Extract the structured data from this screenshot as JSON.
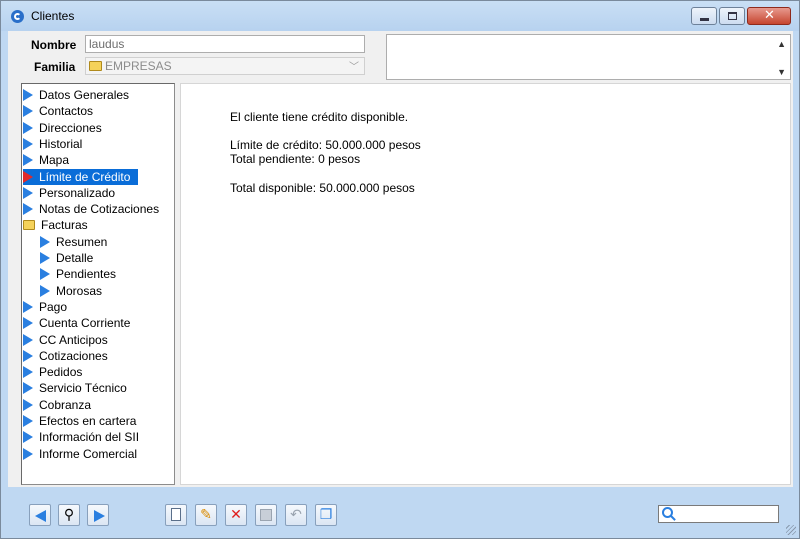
{
  "window": {
    "title": "Clientes"
  },
  "form": {
    "nombre_label": "Nombre",
    "nombre_value": "laudus",
    "familia_label": "Familia",
    "familia_value": "EMPRESAS"
  },
  "tree": {
    "items": [
      {
        "label": "Datos Generales",
        "icon": "arrow-icon"
      },
      {
        "label": "Contactos",
        "icon": "arrow-icon"
      },
      {
        "label": "Direcciones",
        "icon": "arrow-icon"
      },
      {
        "label": "Historial",
        "icon": "arrow-icon"
      },
      {
        "label": "Mapa",
        "icon": "arrow-icon"
      },
      {
        "label": "Límite de Crédito",
        "icon": "arrow-red-icon",
        "selected": true
      },
      {
        "label": "Personalizado",
        "icon": "arrow-icon"
      },
      {
        "label": "Notas de Cotizaciones",
        "icon": "arrow-icon"
      },
      {
        "label": "Facturas",
        "icon": "folder-icon"
      },
      {
        "label": "Resumen",
        "icon": "arrow-icon",
        "child": true
      },
      {
        "label": "Detalle",
        "icon": "arrow-icon",
        "child": true
      },
      {
        "label": "Pendientes",
        "icon": "arrow-icon",
        "child": true
      },
      {
        "label": "Morosas",
        "icon": "arrow-icon",
        "child": true
      },
      {
        "label": "Pago",
        "icon": "arrow-icon"
      },
      {
        "label": "Cuenta Corriente",
        "icon": "arrow-icon"
      },
      {
        "label": "CC Anticipos",
        "icon": "arrow-icon"
      },
      {
        "label": "Cotizaciones",
        "icon": "arrow-icon"
      },
      {
        "label": "Pedidos",
        "icon": "arrow-icon"
      },
      {
        "label": "Servicio Técnico",
        "icon": "arrow-icon"
      },
      {
        "label": "Cobranza",
        "icon": "arrow-icon"
      },
      {
        "label": "Efectos en cartera",
        "icon": "arrow-icon"
      },
      {
        "label": "Información del SII",
        "icon": "arrow-icon"
      },
      {
        "label": "Informe Comercial",
        "icon": "arrow-icon"
      }
    ]
  },
  "content": {
    "status": "El cliente tiene crédito disponible.",
    "limit": "Límite de crédito: 50.000.000 pesos",
    "pending": "Total pendiente: 0 pesos",
    "available": "Total disponible: 50.000.000 pesos"
  },
  "colors": {
    "accent": "#2a7fe0",
    "selection": "#0a6dd8",
    "frame": "#bfd8f2"
  }
}
